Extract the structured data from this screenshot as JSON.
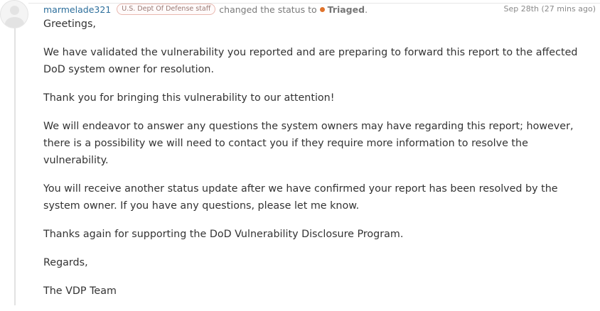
{
  "activity": {
    "username": "marmelade321",
    "badge": "U.S. Dept Of Defense staff",
    "action": "changed the status to",
    "status": "Triaged",
    "status_color": "#e0732b",
    "status_suffix": ".",
    "timestamp": "Sep 28th (27 mins ago)"
  },
  "message": {
    "paragraphs": [
      "Greetings,",
      "We have validated the vulnerability you reported and are preparing to forward this report to the affected DoD system owner for resolution.",
      "Thank you for bringing this vulnerability to our attention!",
      "We will endeavor to answer any questions the system owners may have regarding this report; however, there is a possibility we will need to contact you if they require more information to resolve the vulnerability.",
      "You will receive another status update after we have confirmed your report has been resolved by the system owner. If you have any questions, please let me know.",
      "Thanks again for supporting the DoD Vulnerability Disclosure Program.",
      "Regards,",
      "The VDP Team"
    ]
  }
}
